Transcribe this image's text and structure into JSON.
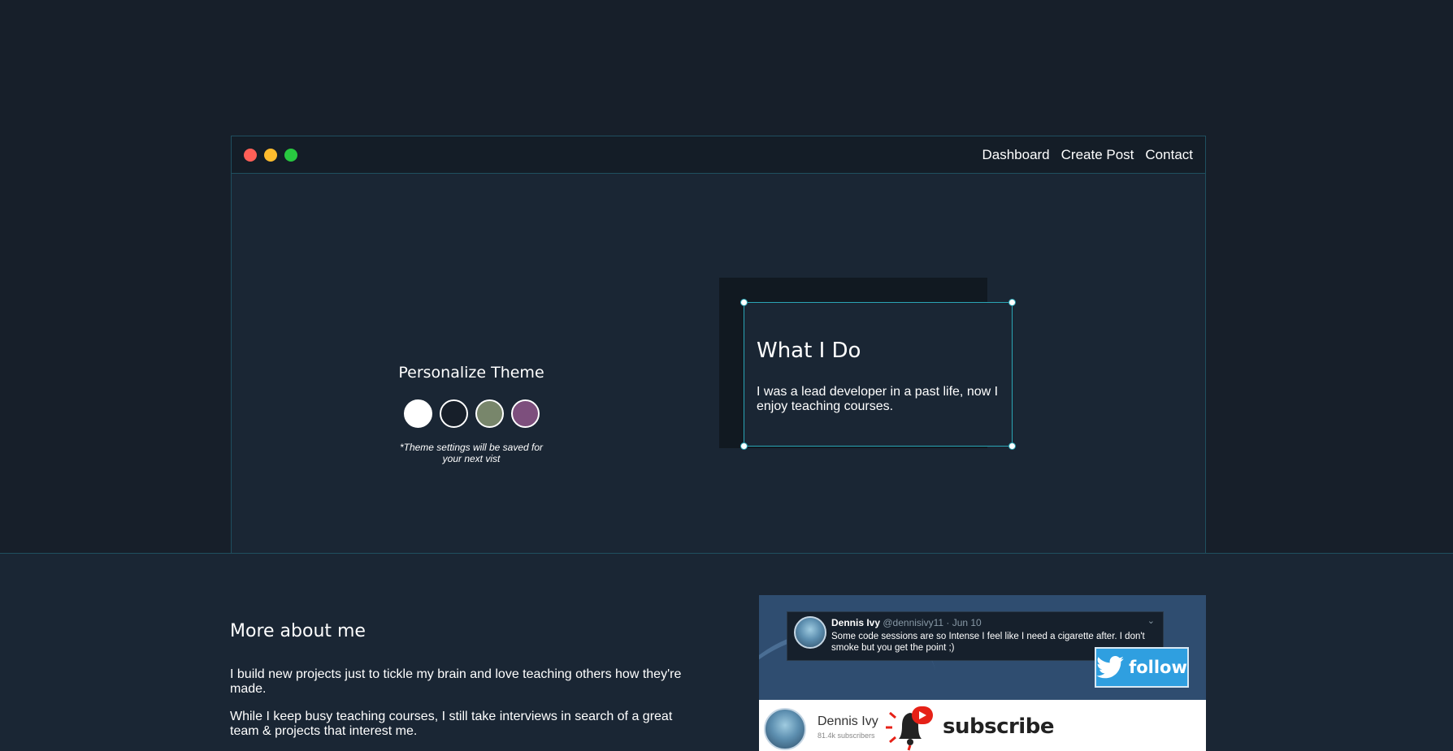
{
  "nav": {
    "items": [
      {
        "label": "Dashboard"
      },
      {
        "label": "Create Post"
      },
      {
        "label": "Contact"
      }
    ]
  },
  "window": {
    "dots": [
      {
        "name": "close",
        "color": "#ff5f57"
      },
      {
        "name": "minimize",
        "color": "#febc2e"
      },
      {
        "name": "maximize",
        "color": "#28c840"
      }
    ]
  },
  "theme": {
    "title": "Personalize Theme",
    "note": "*Theme settings will be saved for your next vist",
    "swatches": [
      {
        "name": "light",
        "color": "#ffffff"
      },
      {
        "name": "dark",
        "color": "#171f2a"
      },
      {
        "name": "green",
        "color": "#78866b"
      },
      {
        "name": "purple",
        "color": "#7d4f7d"
      }
    ]
  },
  "what_i_do": {
    "title": "What I Do",
    "text": "I was a lead developer in a past life, now I enjoy teaching courses."
  },
  "about": {
    "title": "More about me",
    "paragraphs": [
      "I build new projects just to tickle my brain and love teaching others how they're made.",
      "While I keep busy teaching courses, I still take interviews in search of a great team & projects that interest me."
    ]
  },
  "social": {
    "tweet": {
      "name": "Dennis Ivy",
      "handle": "@dennisivy11 · Jun 10",
      "text": "Some code sessions are so Intense I feel like I need a cigarette after. I don't smoke but you get the point ;)"
    },
    "follow_label": "follow",
    "youtube": {
      "name": "Dennis Ivy",
      "subscribers": "81.4k subscribers",
      "subscribe_label": "subscribe"
    }
  },
  "colors": {
    "background": "#171f2a",
    "panel": "#1a2634",
    "accent_border": "#2aa5b5",
    "twitter_blue": "#2f9fe0",
    "youtube_red": "#e62117"
  }
}
